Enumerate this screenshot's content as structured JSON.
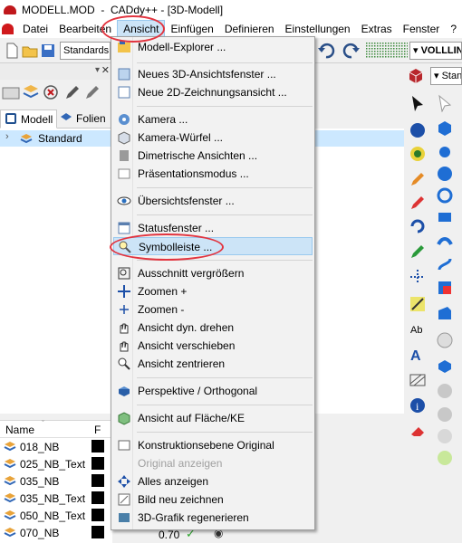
{
  "window": {
    "title": "MODELL.MOD  -  CADdy++ - [3D-Modell]"
  },
  "menubar": {
    "items": [
      "Datei",
      "Bearbeiten",
      "Ansicht",
      "Einfügen",
      "Definieren",
      "Einstellungen",
      "Extras",
      "Fenster",
      "?"
    ],
    "active": "Ansicht"
  },
  "toolbar": {
    "standards_combo": "Standards",
    "linetype_combo": "VOLLLIN",
    "right_combo": "Stan"
  },
  "left_panel": {
    "tabs": [
      "Modell",
      "Folien"
    ],
    "tree_item": "Standard",
    "list_headers": {
      "name": "Name",
      "f": "F"
    },
    "layers": [
      "018_NB",
      "025_NB_Text",
      "035_NB",
      "035_NB_Text",
      "050_NB_Text",
      "070_NB"
    ],
    "bottom_value": "0.70"
  },
  "dropdown": {
    "items": [
      {
        "label": "Modell-Explorer ...",
        "icon": "explorer-icon"
      },
      {
        "label": "Neues 3D-Ansichtsfenster ...",
        "icon": "view3d-icon"
      },
      {
        "label": "Neue 2D-Zeichnungsansicht ...",
        "icon": "view2d-icon"
      },
      {
        "label": "Kamera ...",
        "icon": "camera-icon"
      },
      {
        "label": "Kamera-Würfel ...",
        "icon": "cube-icon"
      },
      {
        "label": "Dimetrische Ansichten ...",
        "icon": "dimetric-icon"
      },
      {
        "label": "Präsentationsmodus ...",
        "icon": "presentation-icon"
      },
      {
        "label": "Übersichtsfenster ...",
        "icon": "eye-icon"
      },
      {
        "label": "Statusfenster ...",
        "icon": "status-window-icon"
      },
      {
        "label": "Symbolleiste ...",
        "icon": "magnifier-icon"
      },
      {
        "label": "Ausschnitt vergrößern",
        "icon": "zoom-window-icon"
      },
      {
        "label": "Zoomen +",
        "icon": "zoom-plus-icon"
      },
      {
        "label": "Zoomen -",
        "icon": "zoom-minus-icon"
      },
      {
        "label": "Ansicht dyn. drehen",
        "icon": "hand-rotate-icon"
      },
      {
        "label": "Ansicht verschieben",
        "icon": "hand-pan-icon"
      },
      {
        "label": "Ansicht zentrieren",
        "icon": "center-view-icon"
      },
      {
        "label": "Perspektive / Orthogonal",
        "icon": "perspective-icon"
      },
      {
        "label": "Ansicht auf Fläche/KE",
        "icon": "face-view-icon"
      },
      {
        "label": "Konstruktionsebene Original",
        "icon": "construction-plane-icon"
      },
      {
        "label": "Original anzeigen",
        "icon": "none"
      },
      {
        "label": "Alles anzeigen",
        "icon": "show-all-icon"
      },
      {
        "label": "Bild neu zeichnen",
        "icon": "redraw-icon"
      },
      {
        "label": "3D-Grafik regenerieren",
        "icon": "regenerate-icon"
      }
    ],
    "highlighted": "Symbolleiste ...",
    "disabled": "Original anzeigen"
  },
  "colors": {
    "accent_highlight": "#cce4f7",
    "ring": "#e2343f",
    "selection": "#cce8ff"
  }
}
